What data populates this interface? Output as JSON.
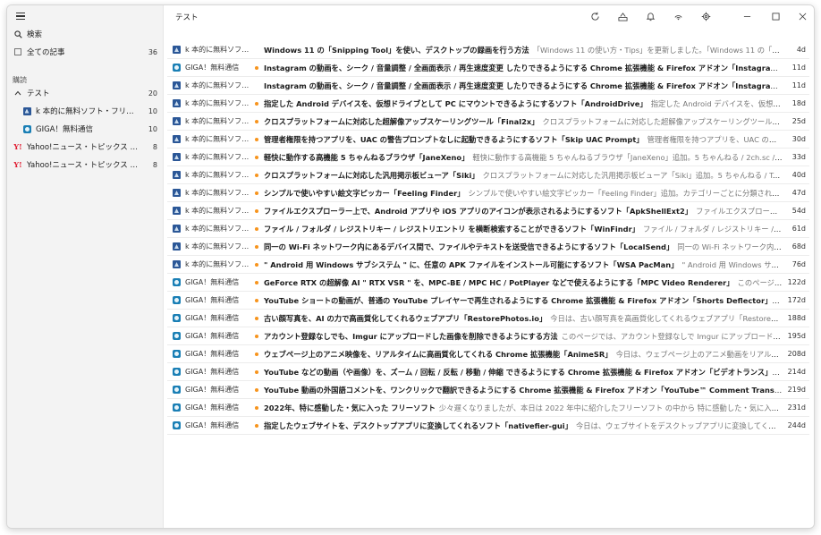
{
  "window_title": "テスト",
  "sidebar": {
    "search_label": "検索",
    "all_articles": {
      "label": "全ての記事",
      "count": "36"
    },
    "section_label": "購読",
    "folder": {
      "label": "テスト",
      "count": "20"
    },
    "feeds": [
      {
        "label": "k 本的に無料ソフト・フリーソフト 更新...",
        "count": "10",
        "icon": "forest-icon"
      },
      {
        "label": "GIGA！無料通信",
        "count": "10",
        "icon": "giga-icon"
      }
    ],
    "yahoo_feeds": [
      {
        "label": "Yahoo!ニュース・トピックス - 主要",
        "count": "8"
      },
      {
        "label": "Yahoo!ニュース・トピックス - エンタメ",
        "count": "8"
      }
    ],
    "yahoo_logo": "Y!"
  },
  "articles": [
    {
      "source": "k 本的に無料ソフト・フ...",
      "icon": "forest",
      "dot": false,
      "title": "Windows 11 の「Snipping Tool」を使い、デスクトップの録画を行う方法",
      "snippet": "「Windows 11 の使い方・Tips」を更新しました。「Windows 11 の「Snipping Tool」を使...",
      "age": "4d"
    },
    {
      "source": "GIGA！無料通信",
      "icon": "giga",
      "dot": true,
      "title": "Instagram の動画を、シーク / 音量調整 / 全画面表示 / 再生速度変更 したりできるようにする Chrome 拡張機能 & Firefox アドオン「Instagram Video Control」",
      "snippet": "",
      "age": "11d"
    },
    {
      "source": "k 本的に無料ソフト・フ...",
      "icon": "forest",
      "dot": false,
      "title": "Instagram の動画を、シーク / 音量調整 / 全画面表示 / 再生速度変更 したりできるようにする Chrome 拡張機能 & Firefox アドオン「Instagram Video Control」",
      "snippet": "",
      "age": "11d"
    },
    {
      "source": "k 本的に無料ソフト・フ...",
      "icon": "forest",
      "dot": true,
      "title": "指定した Android デバイスを、仮想ドライブとして PC にマウントできるようにするソフト「AndroidDrive」",
      "snippet": "指定した Android デバイスを、仮想ドライブとして PC にマウントでき...",
      "age": "18d"
    },
    {
      "source": "k 本的に無料ソフト・フ...",
      "icon": "forest",
      "dot": true,
      "title": "クロスプラットフォームに対応した超解像アップスケーリングツール「Final2x」",
      "snippet": "クロスプラットフォームに対応した超解像アップスケーリングツール「Final2x」追加。ドラッグ＆ドロップ...",
      "age": "25d"
    },
    {
      "source": "k 本的に無料ソフト・フ...",
      "icon": "forest",
      "dot": true,
      "title": "管理者権限を持つアプリを、UAC の警告プロンプトなしに起動できるようにするソフト「Skip UAC Prompt」",
      "snippet": "管理者権限を持つアプリを、UAC の警告プロンプトなしに起動で...",
      "age": "30d"
    },
    {
      "source": "k 本的に無料ソフト・フ...",
      "icon": "forest",
      "dot": true,
      "title": "軽快に動作する高機能 5 ちゃんねるブラウザ「JaneXeno」",
      "snippet": "軽快に動作する高機能 5 ちゃんねるブラウザ「JaneXeno」追加。5 ちゃんねる / 2ch.sc / まち BBS / おーぷん 2 ちゃ...",
      "age": "33d"
    },
    {
      "source": "k 本的に無料ソフト・フ...",
      "icon": "forest",
      "dot": true,
      "title": "クロスプラットフォームに対応した汎用掲示板ビューア「Siki」",
      "snippet": "クロスプラットフォームに対応した汎用掲示板ビューア「Siki」追加。5 ちゃんねる / Talk.jp / おーぷん 2 ちゃんねる / ...",
      "age": "40d"
    },
    {
      "source": "k 本的に無料ソフト・フ...",
      "icon": "forest",
      "dot": true,
      "title": "シンプルで使いやすい絵文字ピッカー「Feeling Finder」",
      "snippet": "シンプルで使いやすい絵文字ピッカー「Feeling Finder」追加。カテゴリーごとに分類された絵文字リストの中から、任意...",
      "age": "47d"
    },
    {
      "source": "k 本的に無料ソフト・フ...",
      "icon": "forest",
      "dot": true,
      "title": "ファイルエクスプローラー上で、Android アプリや iOS アプリのアイコンが表示されるようにするソフト「ApkShellExt2」",
      "snippet": "ファイルエクスプローラー上で、Android アプリや iOS アプリの...",
      "age": "54d"
    },
    {
      "source": "k 本的に無料ソフト・フ...",
      "icon": "forest",
      "dot": true,
      "title": "ファイル / フォルダ / レジストリキー / レジストリエントリ を横断検索することができるソフト「WinFindr」",
      "snippet": "ファイル / フォルダ / レジストリキー / レジストリエントリ を横断検索する...",
      "age": "61d"
    },
    {
      "source": "k 本的に無料ソフト・フ...",
      "icon": "forest",
      "dot": true,
      "title": "同一の Wi-Fi ネットワーク内にあるデバイス間で、ファイルやテキストを送受信できるようにするソフト「LocalSend」",
      "snippet": "同一の Wi-Fi ネットワーク内にあるデバイス間で、ファイルや...",
      "age": "68d"
    },
    {
      "source": "k 本的に無料ソフト・フ...",
      "icon": "forest",
      "dot": true,
      "title": "\" Android 用 Windows サブシステム \" に、任意の APK ファイルをインストール可能にするソフト「WSA PacMan」",
      "snippet": "\" Android 用 Windows サブシステム \" に、任意の APK...",
      "age": "76d"
    },
    {
      "source": "GIGA！無料通信",
      "icon": "giga",
      "dot": true,
      "title": "GeForce RTX の超解像 AI \" RTX VSR \" を、MPC-BE / MPC HC / PotPlayer などで使えるようにする「MPC Video Renderer」",
      "snippet": "このページでは、NVIDIA の超解像 AI...",
      "age": "122d"
    },
    {
      "source": "GIGA！無料通信",
      "icon": "giga",
      "dot": true,
      "title": "YouTube ショートの動画が、普通の YouTube プレイヤーで再生されるようにする Chrome 拡張機能 & Firefox アドオン「Shorts Deflector」",
      "snippet": "今日は、YouTube ショート...",
      "age": "172d"
    },
    {
      "source": "GIGA！無料通信",
      "icon": "giga",
      "dot": true,
      "title": "古い顔写真を、AI の力で高画質化してくれるウェブアプリ「RestorePhotos.io」",
      "snippet": "今日は、古い顔写真を高画質化してくれるウェブアプリ「RestorePhotos.io」を紹介しようと...",
      "age": "188d"
    },
    {
      "source": "GIGA！無料通信",
      "icon": "giga",
      "dot": true,
      "title": "アカウント登録なしでも、Imgur にアップロードした画像を削除できるようにする方法",
      "snippet": "このページでは、アカウント登録なしで Imgur にアップロードした画像を、自分のタイミング...",
      "age": "195d"
    },
    {
      "source": "GIGA！無料通信",
      "icon": "giga",
      "dot": true,
      "title": "ウェブページ上のアニメ映像を、リアルタイムに高画質化してくれる Chrome 拡張機能「AnimeSR」",
      "snippet": "今日は、ウェブページ上のアニメ動画をリアルタイムに高画質化してくれる...",
      "age": "208d"
    },
    {
      "source": "GIGA！無料通信",
      "icon": "giga",
      "dot": true,
      "title": "YouTube などの動画（や画像）を、ズーム / 回転 / 反転 / 移動 / 伸縮 できるようにする Chrome 拡張機能 & Firefox アドオン「ビデオトランス」",
      "snippet": "今日は、YouTube な...",
      "age": "214d"
    },
    {
      "source": "GIGA！無料通信",
      "icon": "giga",
      "dot": true,
      "title": "YouTube 動画の外国語コメントを、ワンクリックで翻訳できるようにする Chrome 拡張機能 & Firefox アドオン「YouTube™ Comment Translate」",
      "snippet": "今日は、YouTube ...",
      "age": "219d"
    },
    {
      "source": "GIGA！無料通信",
      "icon": "giga",
      "dot": true,
      "title": "2022年、特に感動した・気に入った フリーソフト",
      "snippet": "少々遅くなりましたが、本日は 2022 年中に紹介したフリーソフト の中から 特に感動した・気に入った、18 個 ピ...",
      "age": "231d"
    },
    {
      "source": "GIGA！無料通信",
      "icon": "giga",
      "dot": true,
      "title": "指定したウェブサイトを、デスクトップアプリに変換してくれるソフト「nativefier-gui」",
      "snippet": "今日は、ウェブサイトをデスクトップアプリに変換してくれるソフト「nativefier-gui」を紹介し...",
      "age": "244d"
    }
  ],
  "colors": {
    "accent_dot": "#f7941d",
    "yahoo": "#e0182d"
  }
}
